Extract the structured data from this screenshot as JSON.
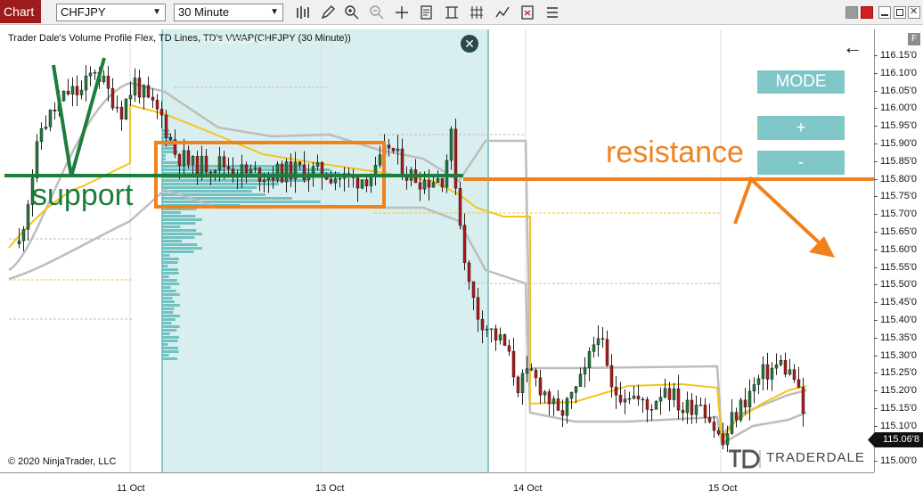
{
  "toolbar": {
    "tab_label": "Chart",
    "instrument": "CHFJPY",
    "timeframe": "30 Minute"
  },
  "chart": {
    "header": "Trader Dale's Volume Profile Flex, TD Lines, TD's VWAP(CHFJPY (30 Minute))",
    "copyright": "© 2020 NinjaTrader, LLC",
    "last_price": "115.06'8",
    "price_ticks": [
      "116.15'0",
      "116.10'0",
      "116.05'0",
      "116.00'0",
      "115.95'0",
      "115.90'0",
      "115.85'0",
      "115.80'0",
      "115.75'0",
      "115.70'0",
      "115.65'0",
      "115.60'0",
      "115.55'0",
      "115.50'0",
      "115.45'0",
      "115.40'0",
      "115.35'0",
      "115.30'0",
      "115.25'0",
      "115.20'0",
      "115.15'0",
      "115.10'0",
      "115.05'0",
      "115.00'0"
    ],
    "time_ticks": [
      "11 Oct",
      "13 Oct",
      "14 Oct",
      "15 Oct"
    ],
    "f_label": "F"
  },
  "panel": {
    "mode_label": "MODE",
    "plus_label": "+",
    "minus_label": "-",
    "close_glyph": "✕",
    "back_glyph": "←"
  },
  "annotations": {
    "support": "support",
    "resistance": "resistance"
  },
  "brand": {
    "name": "TRADERDALE",
    "watermark": "TRADERDALE"
  },
  "colors": {
    "bull": "#1e7b3a",
    "bear": "#b01818",
    "vwap": "#f2c61a",
    "profile_bg": "#cfeaea",
    "support_line": "#1d7d3c",
    "resistance": "#f0821e"
  }
}
